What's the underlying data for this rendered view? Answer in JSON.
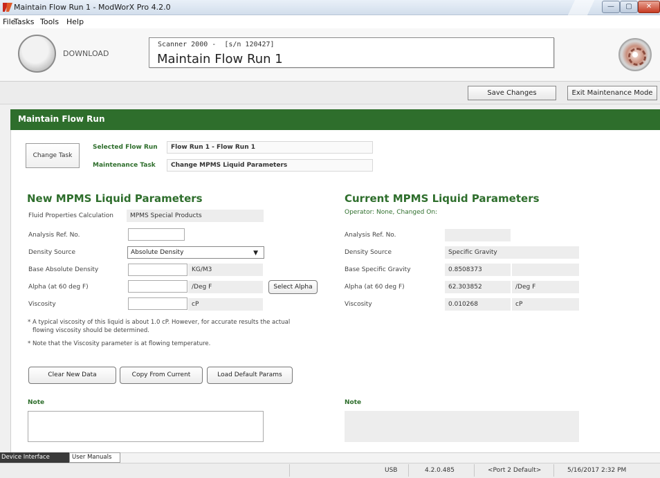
{
  "window": {
    "title": "Maintain Flow Run 1 - ModWorX Pro 4.2.0",
    "minimize_glyph": "—",
    "maximize_glyph": "▢",
    "close_glyph": "✕"
  },
  "menu": [
    "File",
    "Tasks",
    "Tools",
    "Help"
  ],
  "header": {
    "download_label": "DOWNLOAD",
    "device_name": "Scanner 2000 -  [s/n 120427]",
    "screen_title": "Maintain Flow Run 1"
  },
  "toolbar": {
    "save_label": "Save Changes",
    "exit_label": "Exit Maintenance Mode"
  },
  "panel": {
    "title": "Maintain Flow Run",
    "change_task_label": "Change Task",
    "selected_flow_run_label": "Selected Flow Run",
    "selected_flow_run_value": "Flow Run 1 - Flow Run 1",
    "maintenance_task_label": "Maintenance Task",
    "maintenance_task_value": "Change MPMS Liquid Parameters"
  },
  "new_params": {
    "title": "New MPMS Liquid Parameters",
    "fluid_calc_label": "Fluid Properties Calculation",
    "fluid_calc_value": "MPMS Special Products",
    "analysis_label": "Analysis Ref. No.",
    "analysis_value": "",
    "density_source_label": "Density Source",
    "density_source_value": "Absolute Density",
    "base_density_label": "Base Absolute Density",
    "base_density_value": "",
    "base_density_unit": "KG/M3",
    "alpha_label": "Alpha (at 60 deg F)",
    "alpha_value": "",
    "alpha_unit": "/Deg F",
    "select_alpha_label": "Select Alpha",
    "viscosity_label": "Viscosity",
    "viscosity_value": "",
    "viscosity_unit": "cP",
    "note1_line1": "* A typical viscosity of this liquid is about 1.0 cP. However, for accurate results the actual",
    "note1_line2": "flowing viscosity should be determined.",
    "note2": "* Note that the Viscosity parameter is at flowing temperature.",
    "clear_label": "Clear New Data",
    "copy_label": "Copy From Current",
    "load_label": "Load Default Params",
    "note_label": "Note",
    "note_value": ""
  },
  "current_params": {
    "title": "Current MPMS Liquid Parameters",
    "operator_line": "Operator: None, Changed On:",
    "analysis_label": "Analysis Ref. No.",
    "analysis_value": "",
    "density_source_label": "Density Source",
    "density_source_value": "Specific Gravity",
    "base_sg_label": "Base Specific Gravity",
    "base_sg_value": "0.8508373",
    "alpha_label": "Alpha (at 60 deg F)",
    "alpha_value": "62.303852",
    "alpha_unit": "/Deg F",
    "viscosity_label": "Viscosity",
    "viscosity_value": "0.010268",
    "viscosity_unit": "cP",
    "note_label": "Note"
  },
  "bottom_tabs": [
    "Device Interface",
    "User Manuals"
  ],
  "status": {
    "connection": "USB",
    "version": "4.2.0.485",
    "port": "<Port 2 Default>",
    "datetime": "5/16/2017 2:32 PM"
  },
  "colors": {
    "accent_green": "#2e6e2c",
    "close_red": "#c63a22"
  }
}
